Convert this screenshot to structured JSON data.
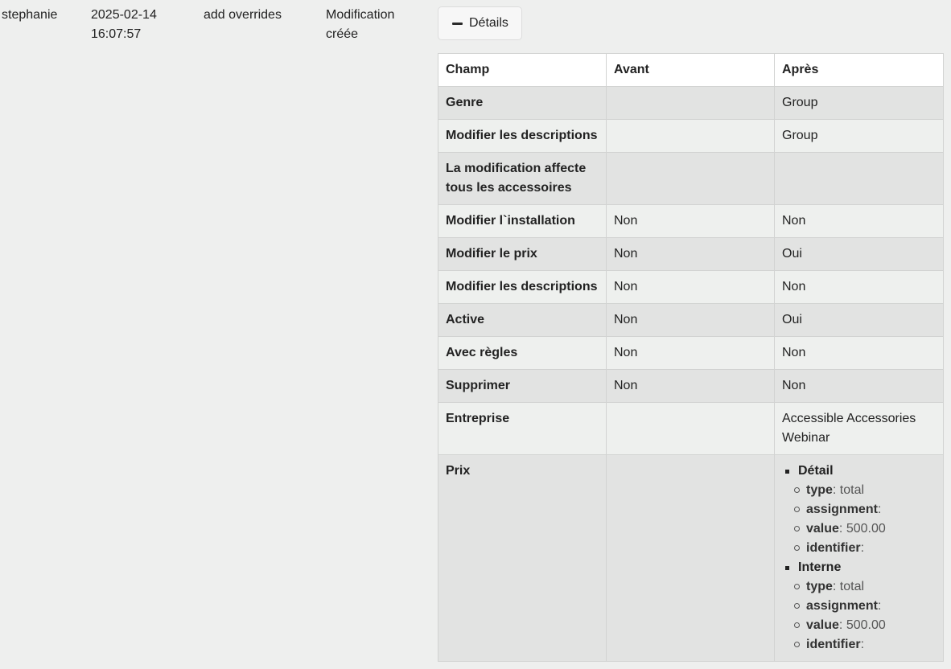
{
  "entry": {
    "user": "stephanie",
    "date": "2025-02-14",
    "time": "16:07:57",
    "description": "add overrides",
    "action_line1": "Modification",
    "action_line2": "créée"
  },
  "details_button": {
    "label": "Détails",
    "icon": "minus-icon"
  },
  "table": {
    "headers": [
      "Champ",
      "Avant",
      "Après"
    ],
    "rows": [
      {
        "field": "Genre",
        "before": "",
        "after": "Group"
      },
      {
        "field": "Modifier les descriptions",
        "before": "",
        "after": "Group"
      },
      {
        "field": "La modification affecte tous les accessoires",
        "before": "",
        "after": ""
      },
      {
        "field": "Modifier l`installation",
        "before": "Non",
        "after": "Non"
      },
      {
        "field": "Modifier le prix",
        "before": "Non",
        "after": "Oui"
      },
      {
        "field": "Modifier les descriptions",
        "before": "Non",
        "after": "Non"
      },
      {
        "field": "Active",
        "before": "Non",
        "after": "Oui"
      },
      {
        "field": "Avec règles",
        "before": "Non",
        "after": "Non"
      },
      {
        "field": "Supprimer",
        "before": "Non",
        "after": "Non"
      },
      {
        "field": "Entreprise",
        "before": "",
        "after": "Accessible Accessories Webinar"
      }
    ],
    "price_row": {
      "field": "Prix",
      "before": "",
      "groups": [
        {
          "title": "Détail",
          "items": [
            {
              "key": "type",
              "value": "total"
            },
            {
              "key": "assignment",
              "value": ""
            },
            {
              "key": "value",
              "value": "500.00"
            },
            {
              "key": "identifier",
              "value": ""
            }
          ]
        },
        {
          "title": "Interne",
          "items": [
            {
              "key": "type",
              "value": "total"
            },
            {
              "key": "assignment",
              "value": ""
            },
            {
              "key": "value",
              "value": "500.00"
            },
            {
              "key": "identifier",
              "value": ""
            }
          ]
        }
      ]
    }
  }
}
